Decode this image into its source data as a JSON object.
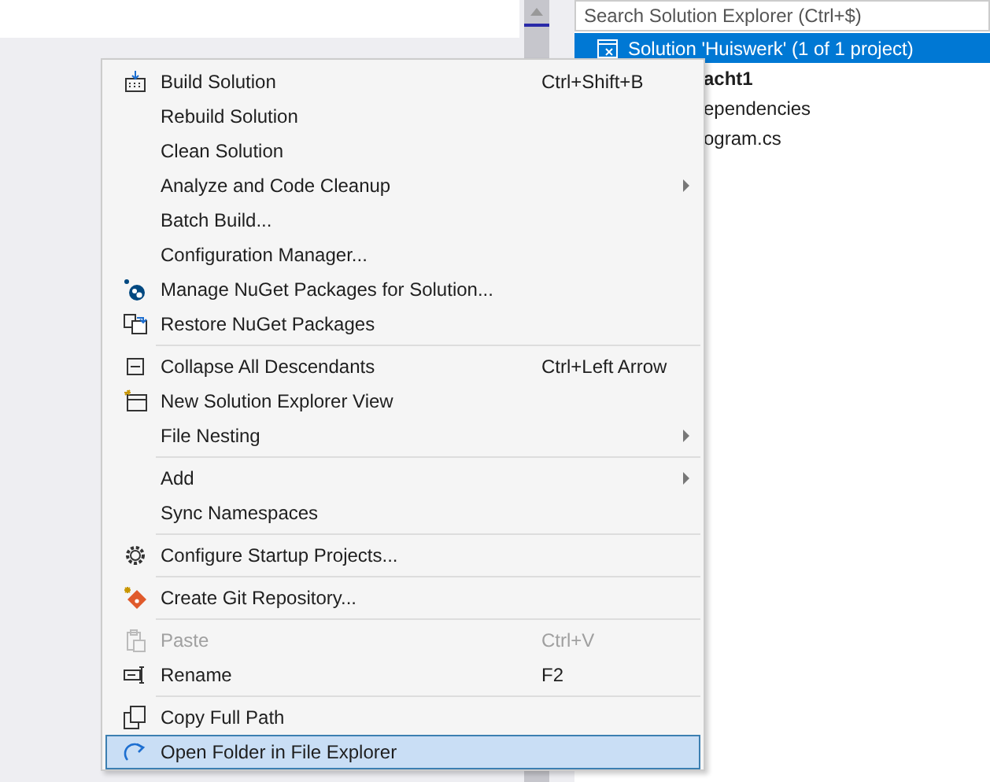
{
  "solution_explorer": {
    "search": {
      "placeholder": "Search Solution Explorer (Ctrl+$)"
    },
    "tree": [
      {
        "label": "Solution 'Huiswerk' (1 of 1 project)",
        "selected": true,
        "bold": false
      },
      {
        "label": "acht1",
        "selected": false,
        "bold": true
      },
      {
        "label": "ependencies",
        "selected": false,
        "bold": false
      },
      {
        "label": "ogram.cs",
        "selected": false,
        "bold": false
      }
    ]
  },
  "context_menu": {
    "items": [
      {
        "kind": "item",
        "label": "Build Solution",
        "shortcut": "Ctrl+Shift+B",
        "submenu": false,
        "disabled": false,
        "selected": false
      },
      {
        "kind": "item",
        "label": "Rebuild Solution",
        "submenu": false,
        "disabled": false,
        "selected": false
      },
      {
        "kind": "item",
        "label": "Clean Solution",
        "submenu": false,
        "disabled": false,
        "selected": false
      },
      {
        "kind": "item",
        "label": "Analyze and Code Cleanup",
        "submenu": true,
        "disabled": false,
        "selected": false
      },
      {
        "kind": "item",
        "label": "Batch Build...",
        "submenu": false,
        "disabled": false,
        "selected": false
      },
      {
        "kind": "item",
        "label": "Configuration Manager...",
        "submenu": false,
        "disabled": false,
        "selected": false
      },
      {
        "kind": "item",
        "label": "Manage NuGet Packages for Solution...",
        "submenu": false,
        "disabled": false,
        "selected": false
      },
      {
        "kind": "item",
        "label": "Restore NuGet Packages",
        "submenu": false,
        "disabled": false,
        "selected": false
      },
      {
        "kind": "separator"
      },
      {
        "kind": "item",
        "label": "Collapse All Descendants",
        "shortcut": "Ctrl+Left Arrow",
        "submenu": false,
        "disabled": false,
        "selected": false
      },
      {
        "kind": "item",
        "label": "New Solution Explorer View",
        "submenu": false,
        "disabled": false,
        "selected": false
      },
      {
        "kind": "item",
        "label": "File Nesting",
        "submenu": true,
        "disabled": false,
        "selected": false
      },
      {
        "kind": "separator"
      },
      {
        "kind": "item",
        "label": "Add",
        "submenu": true,
        "disabled": false,
        "selected": false
      },
      {
        "kind": "item",
        "label": "Sync Namespaces",
        "submenu": false,
        "disabled": false,
        "selected": false
      },
      {
        "kind": "separator"
      },
      {
        "kind": "item",
        "label": "Configure Startup Projects...",
        "submenu": false,
        "disabled": false,
        "selected": false
      },
      {
        "kind": "separator"
      },
      {
        "kind": "item",
        "label": "Create Git Repository...",
        "submenu": false,
        "disabled": false,
        "selected": false
      },
      {
        "kind": "separator"
      },
      {
        "kind": "item",
        "label": "Paste",
        "shortcut": "Ctrl+V",
        "submenu": false,
        "disabled": true,
        "selected": false
      },
      {
        "kind": "item",
        "label": "Rename",
        "shortcut": "F2",
        "submenu": false,
        "disabled": false,
        "selected": false
      },
      {
        "kind": "separator"
      },
      {
        "kind": "item",
        "label": "Copy Full Path",
        "submenu": false,
        "disabled": false,
        "selected": false
      },
      {
        "kind": "item",
        "label": "Open Folder in File Explorer",
        "submenu": false,
        "disabled": false,
        "selected": true
      }
    ]
  }
}
